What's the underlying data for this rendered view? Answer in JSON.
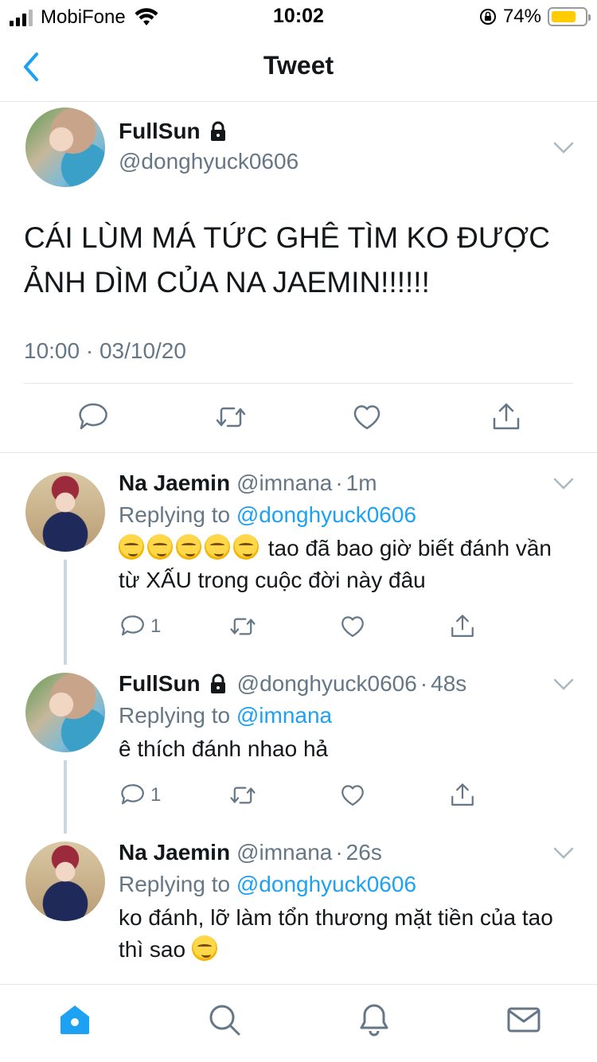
{
  "status_bar": {
    "carrier": "MobiFone",
    "time": "10:02",
    "battery": "74%",
    "battery_level": 0.74,
    "battery_color": "#ffcc00"
  },
  "nav": {
    "title": "Tweet",
    "back_icon": "chevron-left-icon"
  },
  "main_tweet": {
    "name": "FullSun",
    "handle": "@donghyuck0606",
    "text": "CÁI LÙM MÁ TỨC GHÊ TÌM KO ĐƯỢC ẢNH DÌM CỦA NA JAEMIN!!!!!!",
    "meta": "10:00 · 03/10/20"
  },
  "replies": [
    {
      "name": "Na Jaemin",
      "handle": "@imnana",
      "time": "1m",
      "replying_prefix": "Replying to",
      "replying_to": "@donghyuck0606",
      "text": "tao đã bao giờ biết đánh vần từ XẤU trong cuộc đời này đâu",
      "reply_count": "1"
    },
    {
      "name": "FullSun",
      "handle": "@donghyuck0606",
      "time": "48s",
      "replying_prefix": "Replying to",
      "replying_to": "@imnana",
      "text": "ê thích đánh nhao hả",
      "reply_count": "1"
    },
    {
      "name": "Na Jaemin",
      "handle": "@imnana",
      "time": "26s",
      "replying_prefix": "Replying to",
      "replying_to": "@donghyuck0606",
      "text": "ko đánh, lỡ làm tổn thương mặt tiền của tao thì sao"
    }
  ],
  "tabs": [
    "home-icon",
    "search-icon",
    "bell-icon",
    "mail-icon"
  ],
  "colors": {
    "accent": "#1da1f2",
    "muted": "#657786",
    "text": "#14171a"
  }
}
